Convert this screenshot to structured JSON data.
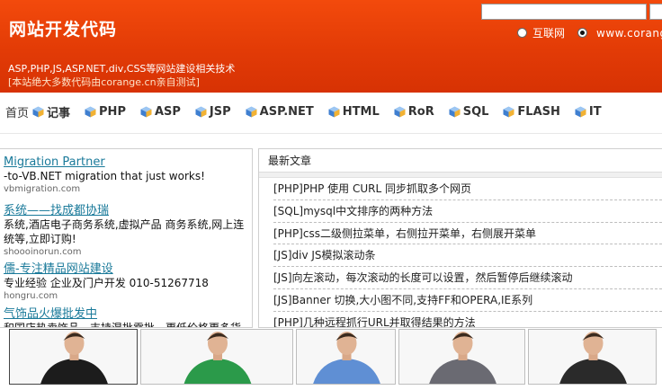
{
  "header": {
    "site_title": "网站开发代码",
    "search_placeholder": "",
    "radio_options": [
      {
        "label": "互联网",
        "checked": false
      },
      {
        "label": "www.corange",
        "checked": true
      }
    ],
    "subtitle": "ASP,PHP,JS,ASP.NET,div,CSS等网站建设相关技术",
    "note": "[本站绝大多数代码由corange.cn亲自测试]"
  },
  "nav": {
    "items": [
      {
        "label": "首页",
        "icon": ""
      },
      {
        "label": "记事",
        "icon": "cube-icon"
      },
      {
        "label": "PHP",
        "icon": "cube-icon"
      },
      {
        "label": "ASP",
        "icon": "cube-icon"
      },
      {
        "label": "JSP",
        "icon": "cube-icon"
      },
      {
        "label": "ASP.NET",
        "icon": "cube-icon"
      },
      {
        "label": "HTML",
        "icon": "cube-icon"
      },
      {
        "label": "RoR",
        "icon": "cube-icon"
      },
      {
        "label": "SQL",
        "icon": "cube-icon"
      },
      {
        "label": "FLASH",
        "icon": "cube-icon"
      },
      {
        "label": "IT",
        "icon": "cube-icon"
      }
    ]
  },
  "ads": [
    {
      "title": "Migration Partner",
      "desc": "-to-VB.NET migration that just works!",
      "url": "vbmigration.com"
    },
    {
      "title": "系统——找成都协瑞",
      "desc": "系统,酒店电子商务系统,虚拟产品 商务系统,网上连",
      "desc2": "统等,立即订购!",
      "url": "shoooinorun.com"
    },
    {
      "title": "儒-专注精品网站建设",
      "desc": "专业经验 企业及门户开发  010-51267718",
      "url": "hongru.com"
    },
    {
      "title": "气饰品火爆批发中",
      "desc": "和国店热卖饰品，支持混批零批，更低价格更多货"
    }
  ],
  "news": {
    "heading": "最新文章",
    "items": [
      "[PHP]PHP 使用  CURL 同步抓取多个网页",
      "[SQL]mysql中文排序的两种方法",
      "[PHP]css二级侧拉菜单，右侧拉开菜单，右侧展开菜单",
      "[JS]div JS模拟滚动条",
      "[JS]向左滚动，每次滚动的长度可以设置，然后暂停后继续滚动",
      "[JS]Banner 切换,大小图不同,支持FF和OPERA,IE系列",
      "[PHP]几种远程抓行URL并取得结果的方法"
    ]
  },
  "colors": {
    "header_bg": "#e23b06",
    "link": "#1a7a9a",
    "nav_icon": "#3f7fd0"
  },
  "photos": [
    {
      "shirt": "#1c1c1c",
      "bg": "#f7f7f7"
    },
    {
      "shirt": "#2b9a4a",
      "bg": "#f7f7f7"
    },
    {
      "shirt": "#5f8fd4",
      "bg": "#f7f7f7"
    },
    {
      "shirt": "#6a6a72",
      "bg": "#f7f7f7"
    },
    {
      "shirt": "#2a2a2a",
      "bg": "#f7f7f7"
    }
  ]
}
